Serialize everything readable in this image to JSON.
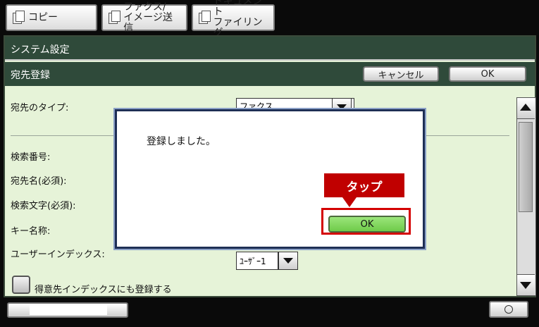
{
  "tabs": [
    {
      "label": "コピー"
    },
    {
      "label_line1": "ファクス/",
      "label_line2": "イメージ送信"
    },
    {
      "label_line1": "ドキュメント",
      "label_line2": "ファイリング"
    }
  ],
  "header": {
    "system_title": "システム設定",
    "section_title": "宛先登録",
    "cancel_label": "キャンセル",
    "ok_label": "OK"
  },
  "form": {
    "dest_type_label": "宛先のタイプ:",
    "dest_type_value": "ファクス",
    "search_number_label": "検索番号:",
    "dest_name_label": "宛先名(必須):",
    "search_text_label": "検索文字(必須):",
    "key_name_label": "キー名称:",
    "user_index_label": "ユーザーインデックス:",
    "user_index_value": "ﾕｰｻﾞｰ1",
    "favorite_label": "得意先インデックスにも登録する"
  },
  "modal": {
    "message": "登録しました。",
    "ok_label": "OK"
  },
  "annotation": {
    "callout_text": "タップ",
    "highlight_color": "#d40000"
  },
  "colors": {
    "header_bar": "#2f4a3a",
    "screen_bg": "#e6f3d8",
    "ok_green": "#7ed857"
  }
}
